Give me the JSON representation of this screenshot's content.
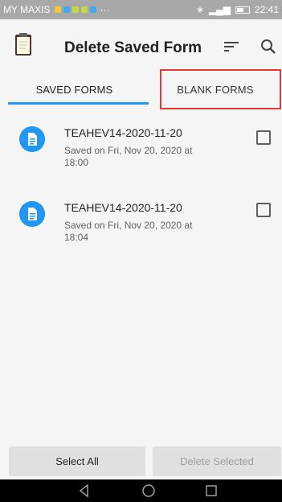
{
  "status_bar": {
    "carrier": "MY MAXIS",
    "time": "22:41"
  },
  "app_bar": {
    "title": "Delete Saved Form",
    "logo_icon": "clipboard-icon",
    "actions": [
      "sort-icon",
      "search-icon"
    ]
  },
  "tabs": [
    {
      "label": "SAVED FORMS",
      "selected": true
    },
    {
      "label": "BLANK FORMS",
      "selected": false
    }
  ],
  "forms": [
    {
      "name": "TEAHEV14-2020-11-20",
      "line1": "Saved on Fri, Nov 20, 2020 at",
      "line2": "18:00",
      "checked": false
    },
    {
      "name": "TEAHEV14-2020-11-20",
      "line1": "Saved on Fri, Nov 20, 2020 at",
      "line2": "18:04",
      "checked": false
    }
  ],
  "bottom_bar": {
    "select_all_label": "Select All",
    "delete_selected_label": "Delete Selected"
  },
  "colors": {
    "accent": "#2196f3",
    "highlight": "#e53935"
  }
}
